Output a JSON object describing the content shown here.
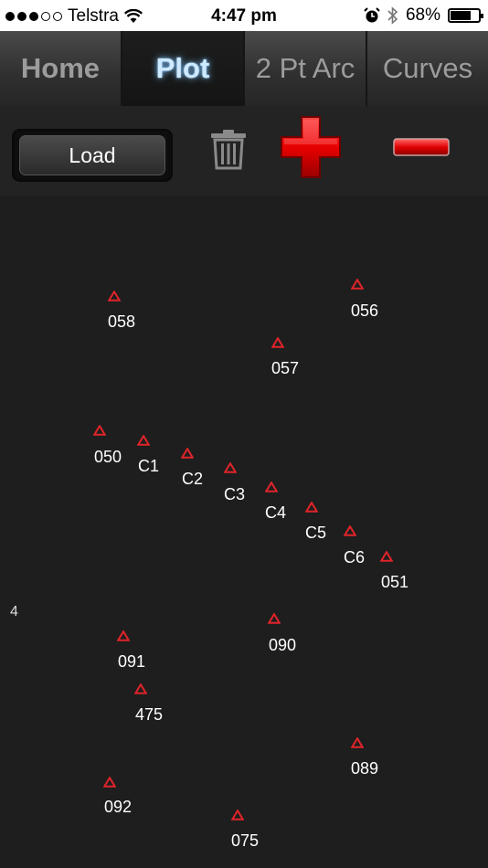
{
  "status_bar": {
    "carrier": "Telstra",
    "time": "4:47 pm",
    "battery_percent": "68%",
    "signal_bars": 3,
    "signal_total": 5
  },
  "tabs": [
    {
      "label": "Home"
    },
    {
      "label": "Plot"
    },
    {
      "label": "2 Pt Arc"
    },
    {
      "label": "Curves"
    }
  ],
  "toolbar": {
    "load_label": "Load"
  },
  "plot": {
    "edge_mark": "4",
    "points": [
      {
        "label": "058"
      },
      {
        "label": "056"
      },
      {
        "label": "057"
      },
      {
        "label": "050"
      },
      {
        "label": "C1"
      },
      {
        "label": "C2"
      },
      {
        "label": "C3"
      },
      {
        "label": "C4"
      },
      {
        "label": "C5"
      },
      {
        "label": "C6"
      },
      {
        "label": "051"
      },
      {
        "label": "090"
      },
      {
        "label": "091"
      },
      {
        "label": "475"
      },
      {
        "label": "089"
      },
      {
        "label": "092"
      },
      {
        "label": "075"
      }
    ]
  },
  "colors": {
    "point_marker": "#e0242a",
    "add_button": "#e80000",
    "active_tab_glow": "#7ac2ff"
  }
}
